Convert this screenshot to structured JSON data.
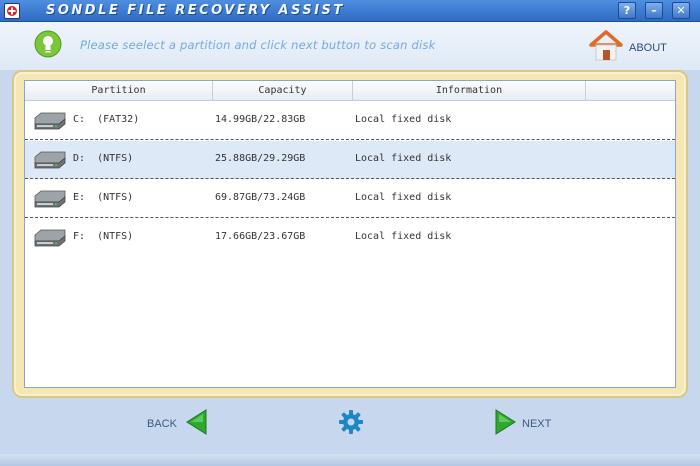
{
  "window": {
    "title": "SONDLE FILE RECOVERY ASSIST",
    "help_glyph": "?",
    "minimize_glyph": "–",
    "close_glyph": "✕"
  },
  "header": {
    "message": "Please seelect a partition and click next button to scan disk",
    "about_label": "ABOUT"
  },
  "table": {
    "columns": [
      "Partition",
      "Capacity",
      "Information"
    ],
    "rows": [
      {
        "partition": "C:  (FAT32)",
        "capacity": "14.99GB/22.83GB",
        "info": "Local fixed disk"
      },
      {
        "partition": "D:  (NTFS)",
        "capacity": "25.88GB/29.29GB",
        "info": "Local fixed disk"
      },
      {
        "partition": "E:  (NTFS)",
        "capacity": "69.87GB/73.24GB",
        "info": "Local fixed disk"
      },
      {
        "partition": "F:  (NTFS)",
        "capacity": "17.66GB/23.67GB",
        "info": "Local fixed disk"
      }
    ]
  },
  "nav": {
    "back_label": "BACK",
    "next_label": "NEXT"
  },
  "colors": {
    "titlebar": "#3a7bd5",
    "panel": "#f3e8b4",
    "arrow_green": "#2fa82f",
    "selected_row": "#dde9f6"
  },
  "icons": [
    "app-icon",
    "lightbulb-icon",
    "home-icon",
    "hard-drive-icon",
    "back-arrow-icon",
    "gear-icon",
    "next-arrow-icon"
  ]
}
